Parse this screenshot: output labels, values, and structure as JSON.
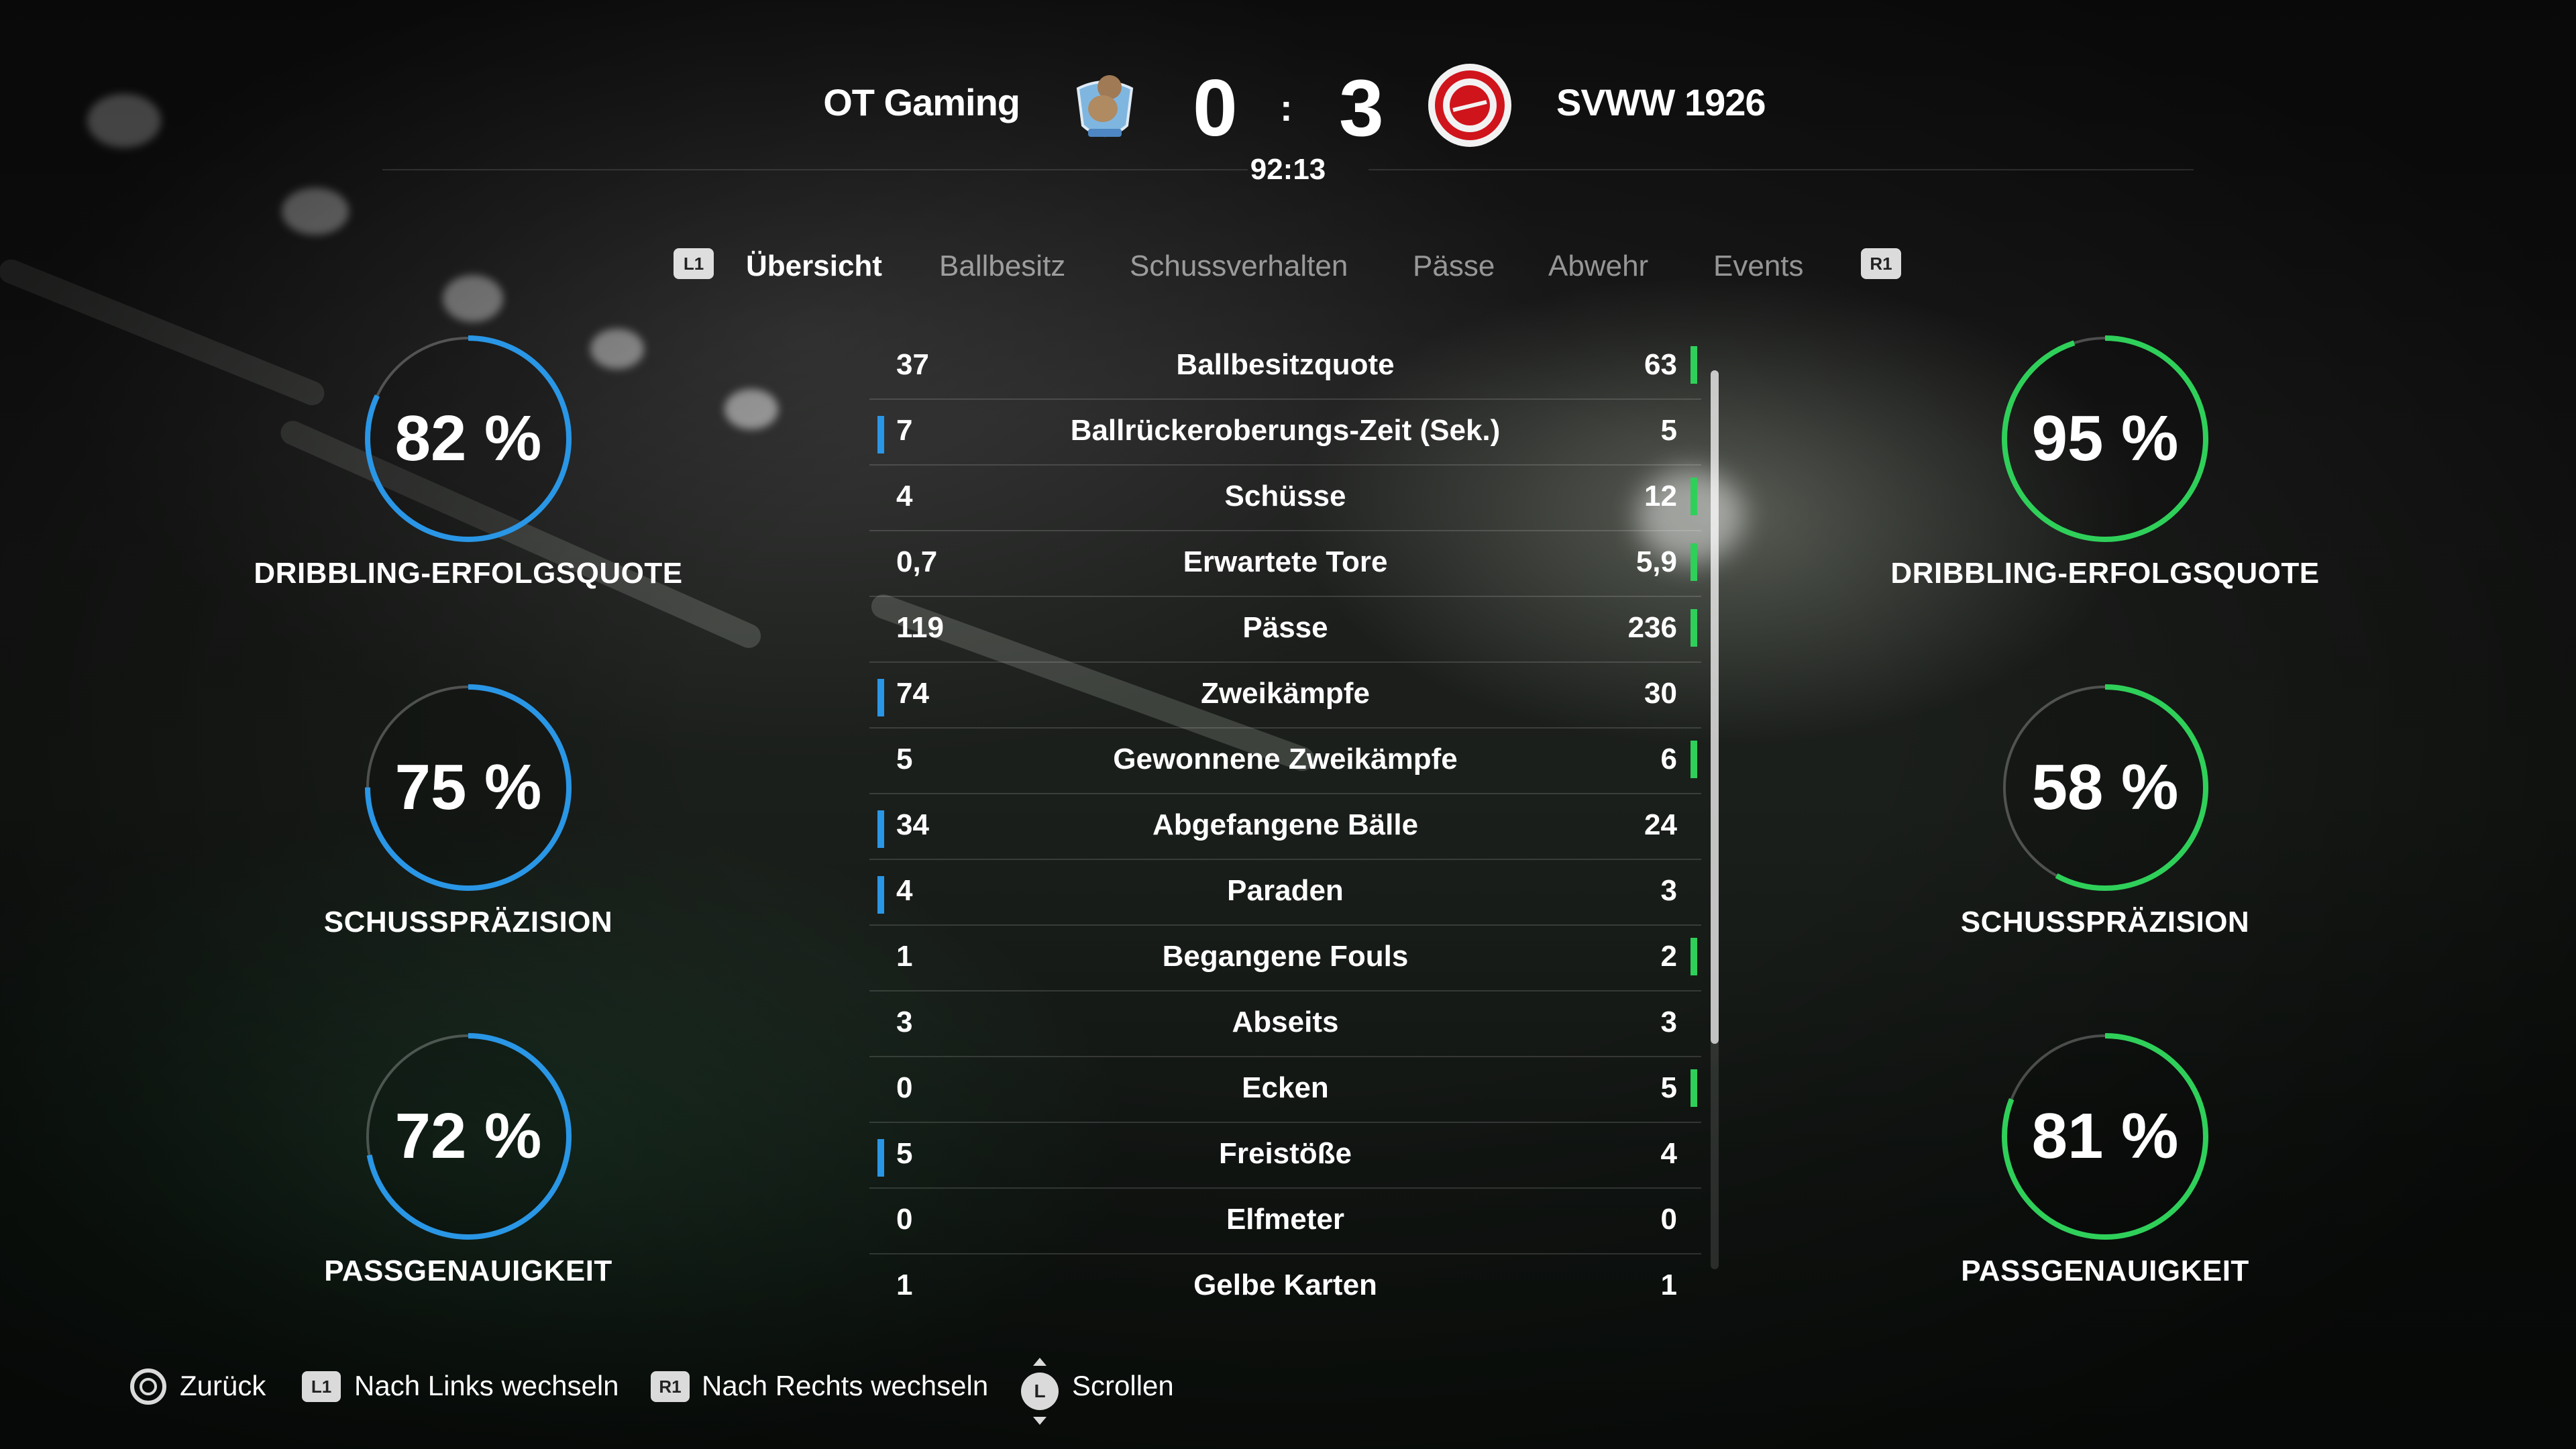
{
  "match": {
    "home_team": "OT Gaming",
    "away_team": "SVWW 1926",
    "home_score": "0",
    "away_score": "3",
    "separator": ":",
    "clock": "92:13"
  },
  "tabs": [
    {
      "label": "Übersicht",
      "active": true
    },
    {
      "label": "Ballbesitz",
      "active": false
    },
    {
      "label": "Schussverhalten",
      "active": false
    },
    {
      "label": "Pässe",
      "active": false
    },
    {
      "label": "Abwehr",
      "active": false
    },
    {
      "label": "Events",
      "active": false
    }
  ],
  "tab_buttons": {
    "left": "L1",
    "right": "R1"
  },
  "home_rings": [
    {
      "value": "82 %",
      "fraction": 0.82,
      "label": "DRIBBLING-ERFOLGSQUOTE"
    },
    {
      "value": "75 %",
      "fraction": 0.75,
      "label": "SCHUSSPRÄZISION"
    },
    {
      "value": "72 %",
      "fraction": 0.72,
      "label": "PASSGENAUIGKEIT"
    }
  ],
  "away_rings": [
    {
      "value": "95 %",
      "fraction": 0.95,
      "label": "DRIBBLING-ERFOLGSQUOTE"
    },
    {
      "value": "58 %",
      "fraction": 0.58,
      "label": "SCHUSSPRÄZISION"
    },
    {
      "value": "81 %",
      "fraction": 0.81,
      "label": "PASSGENAUIGKEIT"
    }
  ],
  "colors": {
    "home_accent": "#2a96e6",
    "away_accent": "#2fd05a"
  },
  "stats": [
    {
      "home": "37",
      "label": "Ballbesitzquote",
      "away": "63",
      "leader": "away"
    },
    {
      "home": "7",
      "label": "Ballrückeroberungs-Zeit (Sek.)",
      "away": "5",
      "leader": "home"
    },
    {
      "home": "4",
      "label": "Schüsse",
      "away": "12",
      "leader": "away"
    },
    {
      "home": "0,7",
      "label": "Erwartete Tore",
      "away": "5,9",
      "leader": "away"
    },
    {
      "home": "119",
      "label": "Pässe",
      "away": "236",
      "leader": "away"
    },
    {
      "home": "74",
      "label": "Zweikämpfe",
      "away": "30",
      "leader": "home"
    },
    {
      "home": "5",
      "label": "Gewonnene Zweikämpfe",
      "away": "6",
      "leader": "away"
    },
    {
      "home": "34",
      "label": "Abgefangene Bälle",
      "away": "24",
      "leader": "home"
    },
    {
      "home": "4",
      "label": "Paraden",
      "away": "3",
      "leader": "home"
    },
    {
      "home": "1",
      "label": "Begangene Fouls",
      "away": "2",
      "leader": "away"
    },
    {
      "home": "3",
      "label": "Abseits",
      "away": "3",
      "leader": "none"
    },
    {
      "home": "0",
      "label": "Ecken",
      "away": "5",
      "leader": "away"
    },
    {
      "home": "5",
      "label": "Freistöße",
      "away": "4",
      "leader": "home"
    },
    {
      "home": "0",
      "label": "Elfmeter",
      "away": "0",
      "leader": "none"
    },
    {
      "home": "1",
      "label": "Gelbe Karten",
      "away": "1",
      "leader": "none"
    }
  ],
  "footer": {
    "back": "Zurück",
    "left_switch": "Nach Links wechseln",
    "left_button": "L1",
    "right_switch": "Nach Rechts wechseln",
    "right_button": "R1",
    "scroll": "Scrollen",
    "scroll_button": "L"
  }
}
